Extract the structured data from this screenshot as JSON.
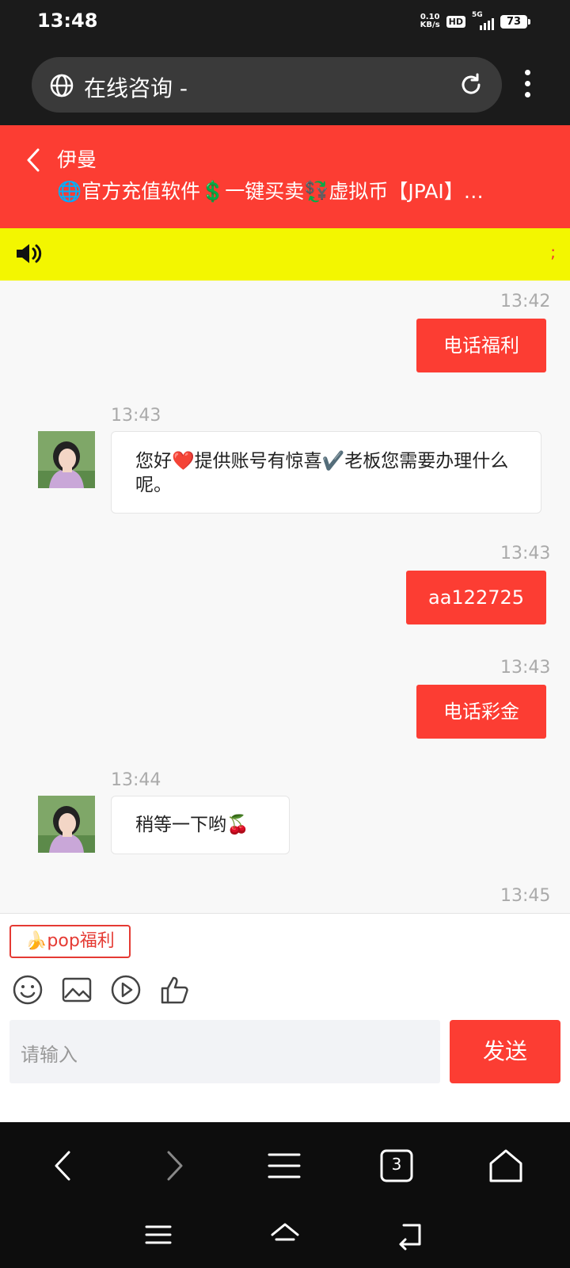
{
  "status": {
    "time": "13:48",
    "speed_value": "0.10",
    "speed_unit": "KB/s",
    "hd": "HD",
    "network": "5G",
    "battery": "73"
  },
  "browser": {
    "url_title": "在线咨询 -"
  },
  "chat": {
    "name": "伊曼",
    "subtitle": "🌐官方充值软件💲一键买卖💱虚拟币【JPAI】…",
    "notice_tail": ";"
  },
  "messages": [
    {
      "time": "13:42",
      "text": "电话福利",
      "from": "me"
    },
    {
      "time": "13:43",
      "text": "您好❤️提供账号有惊喜✔️老板您需要办理什么呢。",
      "from": "agent"
    },
    {
      "time": "13:43",
      "text": "aa122725",
      "from": "me"
    },
    {
      "time": "13:43",
      "text": "电话彩金",
      "from": "me"
    },
    {
      "time": "13:44",
      "text": "稍等一下哟🍒",
      "from": "agent"
    },
    {
      "time": "13:45",
      "text": "",
      "from": "me"
    }
  ],
  "composer": {
    "quick_reply": "🍌pop福利",
    "placeholder": "请输入",
    "send_label": "发送"
  },
  "navbar": {
    "tab_count": "3"
  },
  "colors": {
    "accent": "#fc3d33",
    "notice": "#f3f600",
    "dark": "#1b1b1b"
  }
}
